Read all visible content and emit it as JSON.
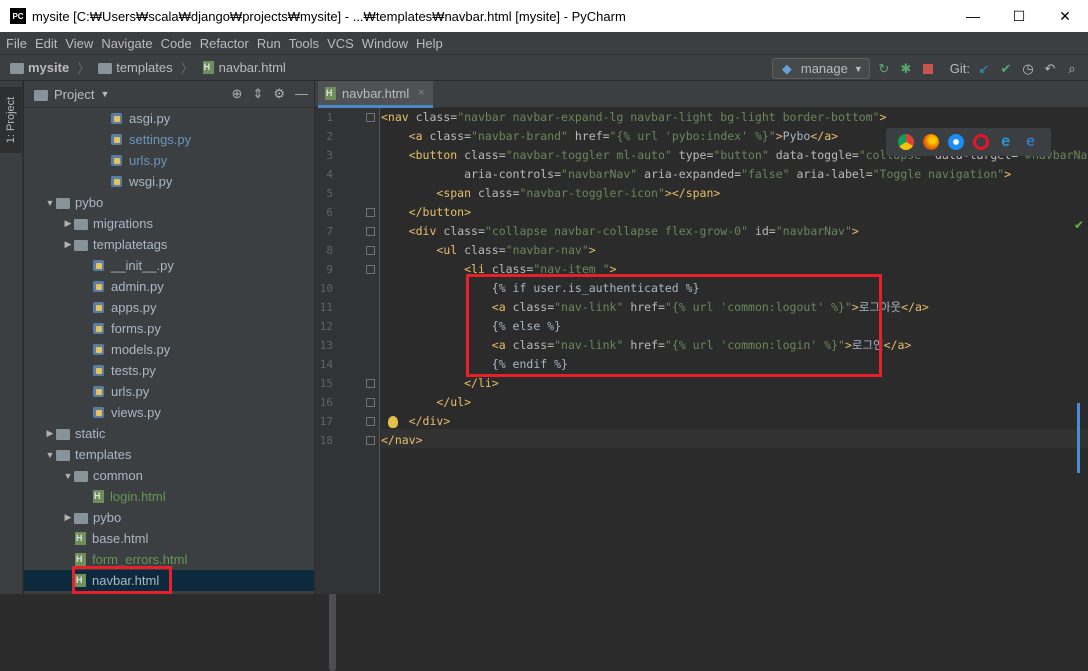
{
  "window": {
    "app_logo": "PC",
    "title": "mysite [C:₩Users₩scala₩django₩projects₩mysite] - ...₩templates₩navbar.html [mysite] - PyCharm",
    "minimize": "—",
    "maximize": "☐",
    "close": "✕"
  },
  "menu": [
    "File",
    "Edit",
    "View",
    "Navigate",
    "Code",
    "Refactor",
    "Run",
    "Tools",
    "VCS",
    "Window",
    "Help"
  ],
  "breadcrumbs": [
    "mysite",
    "templates",
    "navbar.html"
  ],
  "toolbar": {
    "run_config": "manage",
    "git_label": "Git:"
  },
  "side_tab": "1: Project",
  "project_panel": {
    "title": "Project"
  },
  "tree": [
    {
      "label": "asgi.py",
      "kind": "py",
      "style": "py"
    },
    {
      "label": "settings.py",
      "kind": "py",
      "style": "mod"
    },
    {
      "label": "urls.py",
      "kind": "py",
      "style": "mod"
    },
    {
      "label": "wsgi.py",
      "kind": "py",
      "style": "py"
    },
    {
      "label": "pybo",
      "kind": "folder",
      "expanded": true
    },
    {
      "label": "migrations",
      "kind": "folder",
      "expanded": false
    },
    {
      "label": "templatetags",
      "kind": "folder",
      "expanded": false
    },
    {
      "label": "__init__.py",
      "kind": "py",
      "style": "py"
    },
    {
      "label": "admin.py",
      "kind": "py",
      "style": "py"
    },
    {
      "label": "apps.py",
      "kind": "py",
      "style": "py"
    },
    {
      "label": "forms.py",
      "kind": "py",
      "style": "py"
    },
    {
      "label": "models.py",
      "kind": "py",
      "style": "py"
    },
    {
      "label": "tests.py",
      "kind": "py",
      "style": "py"
    },
    {
      "label": "urls.py",
      "kind": "py",
      "style": "py"
    },
    {
      "label": "views.py",
      "kind": "py",
      "style": "py"
    },
    {
      "label": "static",
      "kind": "folder",
      "expanded": false
    },
    {
      "label": "templates",
      "kind": "folder",
      "expanded": true
    },
    {
      "label": "common",
      "kind": "folder",
      "expanded": true
    },
    {
      "label": "login.html",
      "kind": "html",
      "style": "green"
    },
    {
      "label": "pybo",
      "kind": "folder",
      "expanded": false
    },
    {
      "label": "base.html",
      "kind": "html",
      "style": "py"
    },
    {
      "label": "form_errors.html",
      "kind": "html",
      "style": "green"
    },
    {
      "label": "navbar.html",
      "kind": "html",
      "style": "py",
      "selected": true
    }
  ],
  "editor": {
    "tab_label": "navbar.html",
    "tab_close": "×",
    "line_numbers": [
      "1",
      "2",
      "3",
      "4",
      "5",
      "6",
      "7",
      "8",
      "9",
      "10",
      "11",
      "12",
      "13",
      "14",
      "15",
      "16",
      "17",
      "18"
    ],
    "lines": [
      "<nav class=\"navbar navbar-expand-lg navbar-light bg-light border-bottom\">",
      "    <a class=\"navbar-brand\" href=\"{% url 'pybo:index' %}\">Pybo</a>",
      "    <button class=\"navbar-toggler ml-auto\" type=\"button\" data-toggle=\"collapse\" data-target=\"#navbarNav\"",
      "            aria-controls=\"navbarNav\" aria-expanded=\"false\" aria-label=\"Toggle navigation\">",
      "        <span class=\"navbar-toggler-icon\"></span>",
      "    </button>",
      "    <div class=\"collapse navbar-collapse flex-grow-0\" id=\"navbarNav\">",
      "        <ul class=\"navbar-nav\">",
      "            <li class=\"nav-item \">",
      "                {% if user.is_authenticated %}",
      "                <a class=\"nav-link\" href=\"{% url 'common:logout' %}\">로그아웃</a>",
      "                {% else %}",
      "                <a class=\"nav-link\" href=\"{% url 'common:login' %}\">로그인</a>",
      "                {% endif %}",
      "            </li>",
      "        </ul>",
      "    </div>",
      "</nav>"
    ]
  },
  "colors": {
    "tag": "#e8bf6a",
    "attr": "#bababa",
    "value": "#6a8759",
    "template": "#a9b7c6",
    "highlight": "#e8202a"
  }
}
